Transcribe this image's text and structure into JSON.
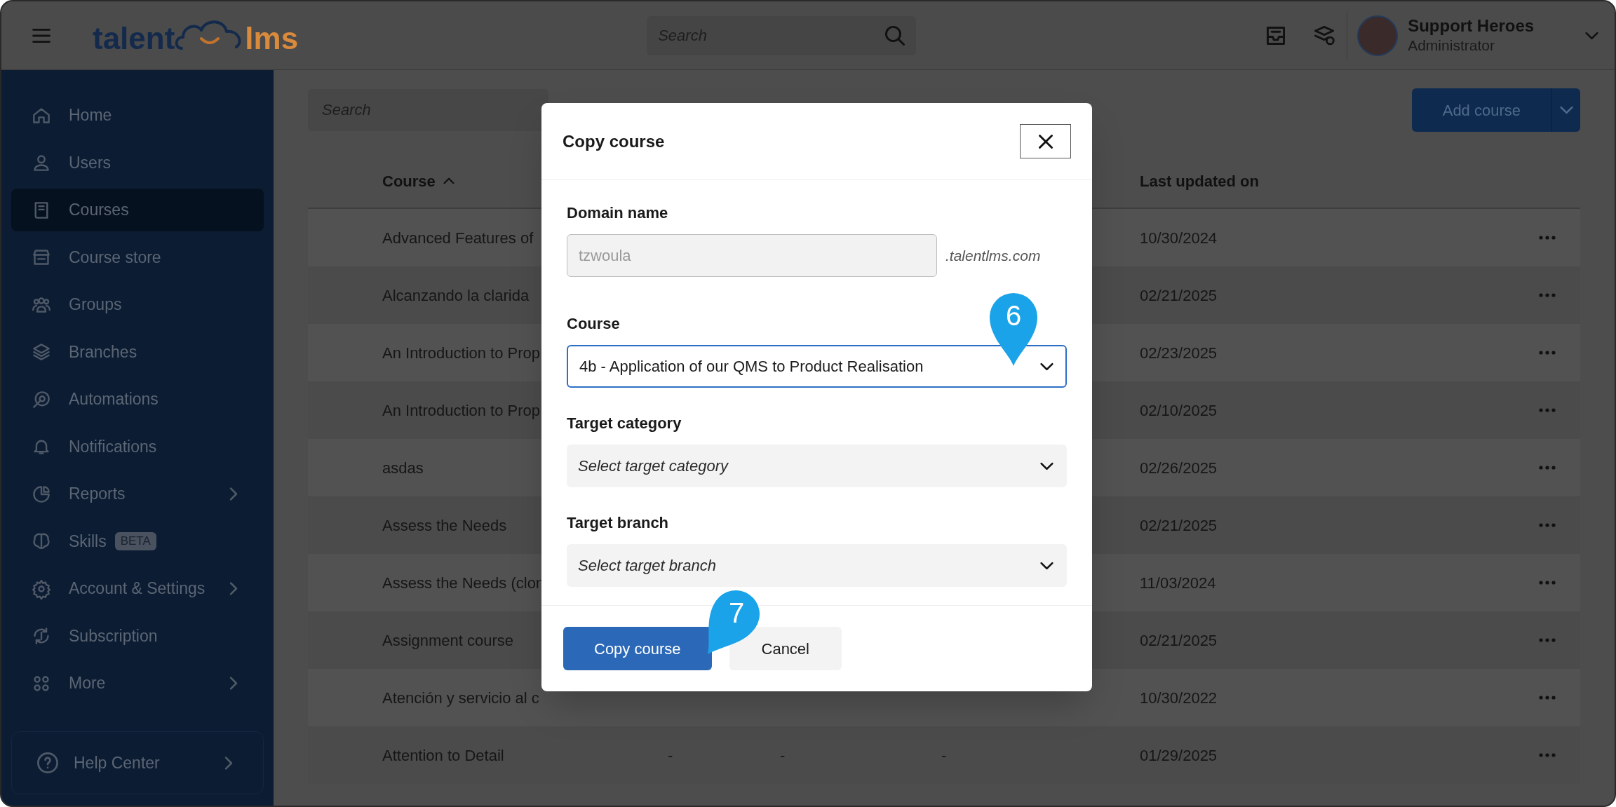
{
  "header": {
    "logo": {
      "left": "talent",
      "right": "lms"
    },
    "search": {
      "placeholder": "Search"
    },
    "user": {
      "name": "Support Heroes",
      "role": "Administrator"
    }
  },
  "sidebar": {
    "items": [
      {
        "label": "Home",
        "selected": false,
        "submenu": false
      },
      {
        "label": "Users",
        "selected": false,
        "submenu": false
      },
      {
        "label": "Courses",
        "selected": true,
        "submenu": false
      },
      {
        "label": "Course store",
        "selected": false,
        "submenu": false
      },
      {
        "label": "Groups",
        "selected": false,
        "submenu": false
      },
      {
        "label": "Branches",
        "selected": false,
        "submenu": false
      },
      {
        "label": "Automations",
        "selected": false,
        "submenu": false
      },
      {
        "label": "Notifications",
        "selected": false,
        "submenu": false
      },
      {
        "label": "Reports",
        "selected": false,
        "submenu": true
      },
      {
        "label": "Skills",
        "selected": false,
        "submenu": false,
        "badge": "BETA"
      },
      {
        "label": "Account & Settings",
        "selected": false,
        "submenu": true
      },
      {
        "label": "Subscription",
        "selected": false,
        "submenu": false
      },
      {
        "label": "More",
        "selected": false,
        "submenu": true
      }
    ],
    "help": {
      "label": "Help Center"
    }
  },
  "toolbar": {
    "search": {
      "placeholder": "Search"
    },
    "add_button": "Add course"
  },
  "table": {
    "columns": [
      "Course",
      "Last updated on"
    ],
    "rows": [
      {
        "course": "Advanced Features of",
        "updated": "10/30/2024"
      },
      {
        "course": "Alcanzando la clarida",
        "updated": "02/21/2025"
      },
      {
        "course": "An Introduction to Prop",
        "updated": "02/23/2025"
      },
      {
        "course": "An Introduction to Prop",
        "updated": "02/10/2025"
      },
      {
        "course": "asdas",
        "updated": "02/26/2025"
      },
      {
        "course": "Assess the Needs",
        "updated": "02/21/2025"
      },
      {
        "course": "Assess the Needs (clon",
        "updated": "11/03/2024"
      },
      {
        "course": "Assignment course",
        "updated": "02/21/2025"
      },
      {
        "course": "Atención y servicio al c",
        "updated": "10/30/2022"
      },
      {
        "course": "Attention to Detail",
        "column_2": "-",
        "column_3": "-",
        "column_4": "-",
        "updated": "01/29/2025"
      }
    ]
  },
  "dialog": {
    "title": "Copy course",
    "fields": [
      {
        "kind": "text",
        "label": "Domain name",
        "value": "tzwoula",
        "suffix": ".talentlms.com",
        "disabled": true,
        "focused": false
      },
      {
        "kind": "select",
        "label": "Course",
        "value": "4b - Application of our QMS to Product Realisation",
        "disabled": false,
        "focused": true
      },
      {
        "kind": "select",
        "label": "Target category",
        "placeholder": "Select target category",
        "disabled": false,
        "focused": false
      },
      {
        "kind": "select",
        "label": "Target branch",
        "placeholder": "Select target branch",
        "disabled": false,
        "focused": false
      }
    ],
    "primary_button": "Copy course",
    "secondary_button": "Cancel"
  },
  "annotations": [
    {
      "label": "6"
    },
    {
      "label": "7"
    }
  ]
}
